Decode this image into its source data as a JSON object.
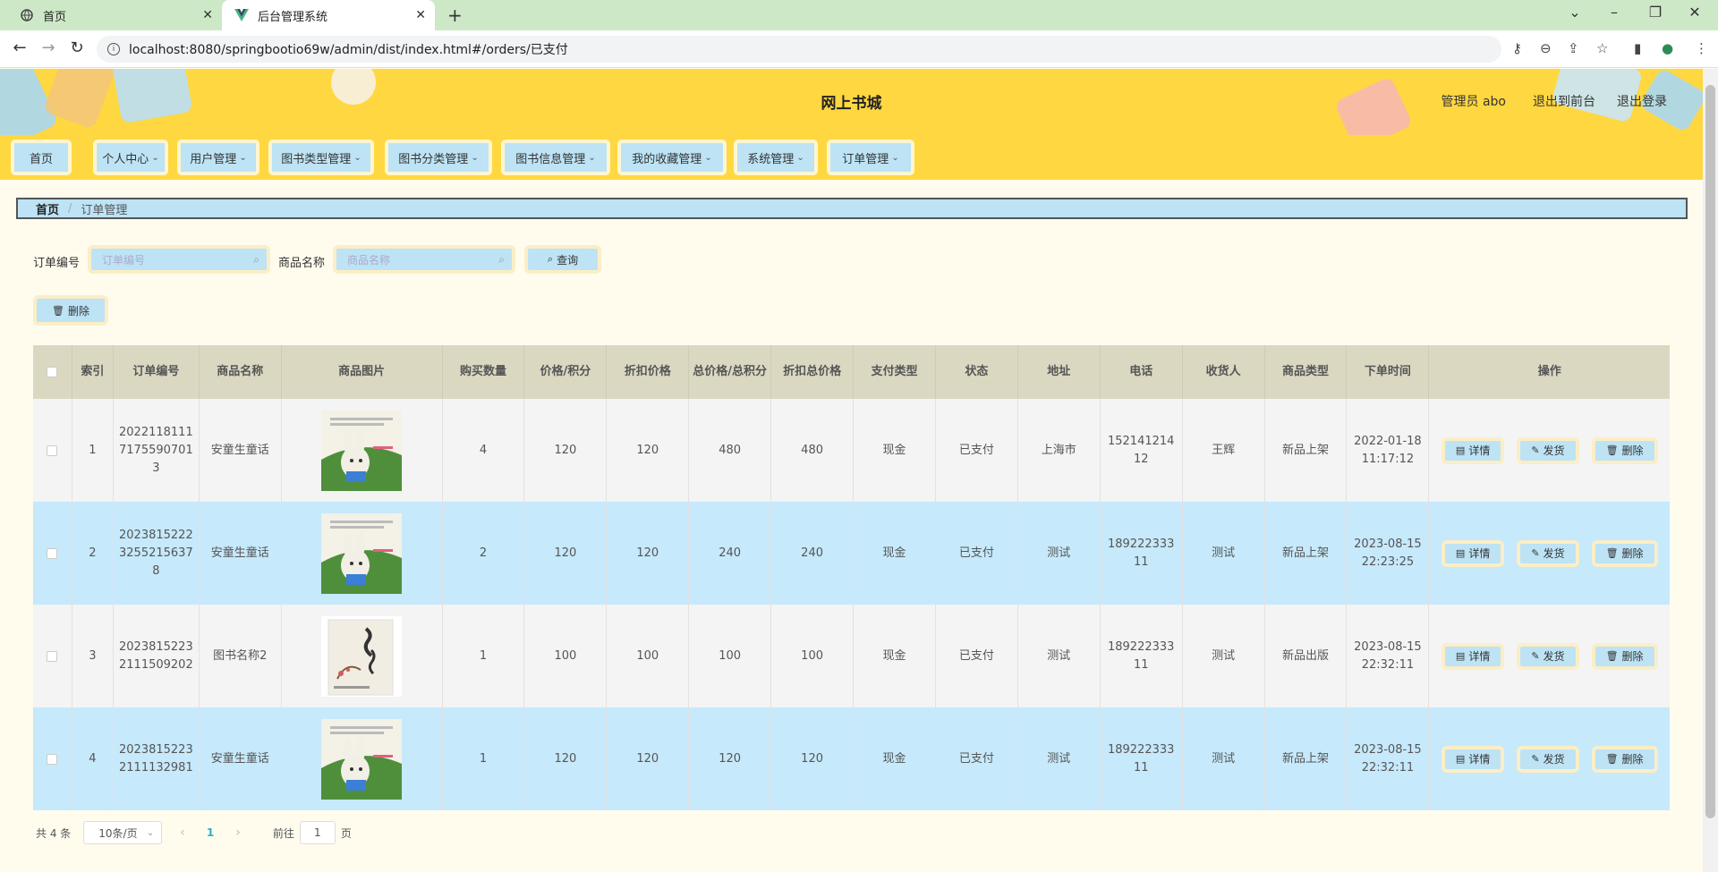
{
  "browser": {
    "tabs": [
      {
        "title": "首页"
      },
      {
        "title": "后台管理系统"
      }
    ],
    "url": "localhost:8080/springbootio69w/admin/dist/index.html#/orders/已支付"
  },
  "header": {
    "site_title": "网上书城",
    "admin_label": "管理员 abo",
    "to_front": "退出到前台",
    "logout": "退出登录"
  },
  "menu": [
    {
      "label": "首页",
      "has_dropdown": false
    },
    {
      "label": "个人中心",
      "has_dropdown": true
    },
    {
      "label": "用户管理",
      "has_dropdown": true
    },
    {
      "label": "图书类型管理",
      "has_dropdown": true
    },
    {
      "label": "图书分类管理",
      "has_dropdown": true
    },
    {
      "label": "图书信息管理",
      "has_dropdown": true
    },
    {
      "label": "我的收藏管理",
      "has_dropdown": true
    },
    {
      "label": "系统管理",
      "has_dropdown": true
    },
    {
      "label": "订单管理",
      "has_dropdown": true
    }
  ],
  "breadcrumb": {
    "home": "首页",
    "separator": "/",
    "current": "订单管理"
  },
  "search": {
    "order_no_label": "订单编号",
    "order_no_placeholder": "订单编号",
    "goods_label": "商品名称",
    "goods_placeholder": "商品名称",
    "query_button": "查询"
  },
  "toolbar": {
    "delete_button": "删除"
  },
  "table": {
    "headers": [
      "索引",
      "订单编号",
      "商品名称",
      "商品图片",
      "购买数量",
      "价格/积分",
      "折扣价格",
      "总价格/总积分",
      "折扣总价格",
      "支付类型",
      "状态",
      "地址",
      "电话",
      "收货人",
      "商品类型",
      "下单时间",
      "操作"
    ],
    "ops": {
      "detail": "详情",
      "ship": "发货",
      "delete": "删除"
    },
    "rows": [
      {
        "index": "1",
        "order_no": "20221181117175590701 3",
        "goods": "安童生童话",
        "image": "book-rabbit-cover",
        "qty": "4",
        "price": "120",
        "discount_price": "120",
        "total": "480",
        "discount_total": "480",
        "pay_type": "现金",
        "status": "已支付",
        "address": "上海市",
        "phone": "15214121412",
        "receiver": "王辉",
        "goods_type": "新品上架",
        "time": "2022-01-18 11:17:12"
      },
      {
        "index": "2",
        "order_no": "20238152223255215637 8",
        "goods": "安童生童话",
        "image": "book-rabbit-cover",
        "qty": "2",
        "price": "120",
        "discount_price": "120",
        "total": "240",
        "discount_total": "240",
        "pay_type": "现金",
        "status": "已支付",
        "address": "测试",
        "phone": "18922233311",
        "receiver": "测试",
        "goods_type": "新品上架",
        "time": "2023-08-15 22:23:25"
      },
      {
        "index": "3",
        "order_no": "20238152232111509202",
        "goods": "图书名称2",
        "image": "book-calligraphy-cover",
        "qty": "1",
        "price": "100",
        "discount_price": "100",
        "total": "100",
        "discount_total": "100",
        "pay_type": "现金",
        "status": "已支付",
        "address": "测试",
        "phone": "18922233311",
        "receiver": "测试",
        "goods_type": "新品出版",
        "time": "2023-08-15 22:32:11"
      },
      {
        "index": "4",
        "order_no": "20238152232111132981",
        "goods": "安童生童话",
        "image": "book-rabbit-cover",
        "qty": "1",
        "price": "120",
        "discount_price": "120",
        "total": "120",
        "discount_total": "120",
        "pay_type": "现金",
        "status": "已支付",
        "address": "测试",
        "phone": "18922233311",
        "receiver": "测试",
        "goods_type": "新品上架",
        "time": "2023-08-15 22:32:11"
      }
    ]
  },
  "pagination": {
    "total_text": "共 4 条",
    "page_size": "10条/页",
    "prev": "‹",
    "current_page": "1",
    "next": "›",
    "goto_label": "前往",
    "goto_value": "1",
    "goto_suffix": "页"
  },
  "colors": {
    "header_bg": "#ffd740",
    "accent_blue": "#bde3f5",
    "button_border": "#fbeec6",
    "row_even": "#c6e9fb",
    "table_head": "#dbd8c2",
    "page_bg": "#fffcee"
  }
}
